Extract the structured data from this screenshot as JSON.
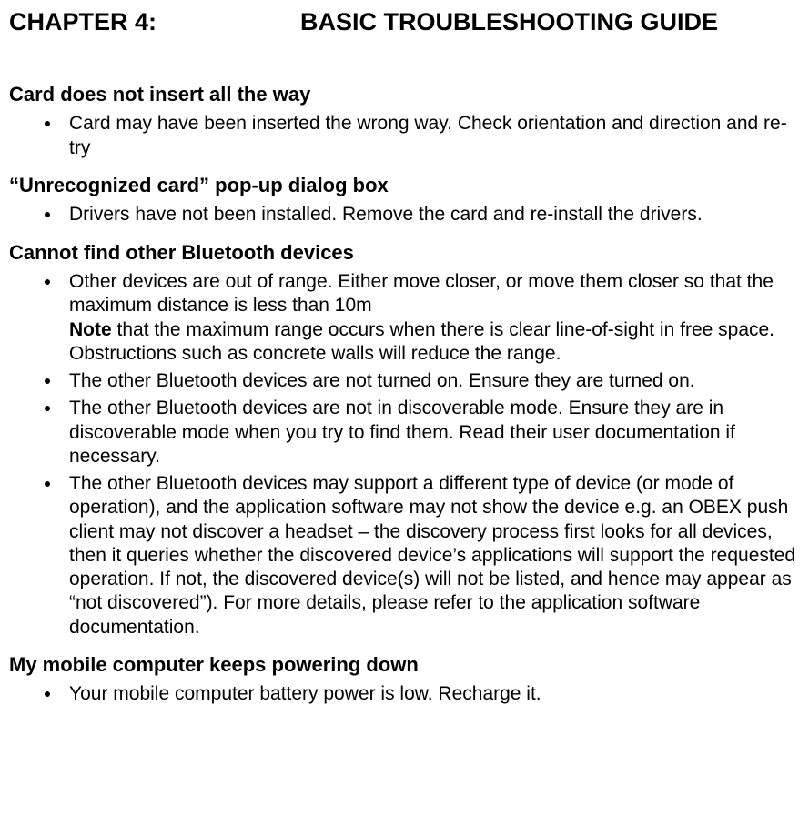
{
  "chapter": {
    "number": "CHAPTER 4:",
    "title": "BASIC TROUBLESHOOTING GUIDE"
  },
  "sections": [
    {
      "heading": "Card does not insert all the way",
      "items": [
        "Card may have been inserted the wrong way.  Check orientation and direction and re-try"
      ]
    },
    {
      "heading": "“Unrecognized card” pop-up dialog box",
      "items": [
        "Drivers have not been installed.  Remove the card and re-install the drivers."
      ]
    },
    {
      "heading": "Cannot find other Bluetooth devices",
      "items": [
        "Other devices are out of range.  Either move closer, or move them closer so that the maximum distance is less than 10m",
        "The other Bluetooth devices are not turned on.  Ensure they are turned on.",
        "The other Bluetooth devices are not in discoverable mode.  Ensure they are in discoverable mode when you try to find them.  Read their user documentation if necessary.",
        "The other Bluetooth devices may support a different type of device (or mode of operation), and the application software may not show the device e.g. an OBEX push client may not discover a headset – the discovery process first looks for all devices, then it queries whether the discovered device’s applications will support the requested operation.  If not, the discovered device(s) will not be listed, and hence may appear as “not discovered”).  For more details, please refer to the application software documentation."
      ],
      "note_label": "Note",
      "note_text": " that the maximum range occurs when there is clear line-of-sight in free space.  Obstructions such as concrete walls will reduce the range."
    },
    {
      "heading": "My mobile computer keeps powering down",
      "items": [
        "Your mobile computer battery power is low.  Recharge it."
      ]
    }
  ]
}
